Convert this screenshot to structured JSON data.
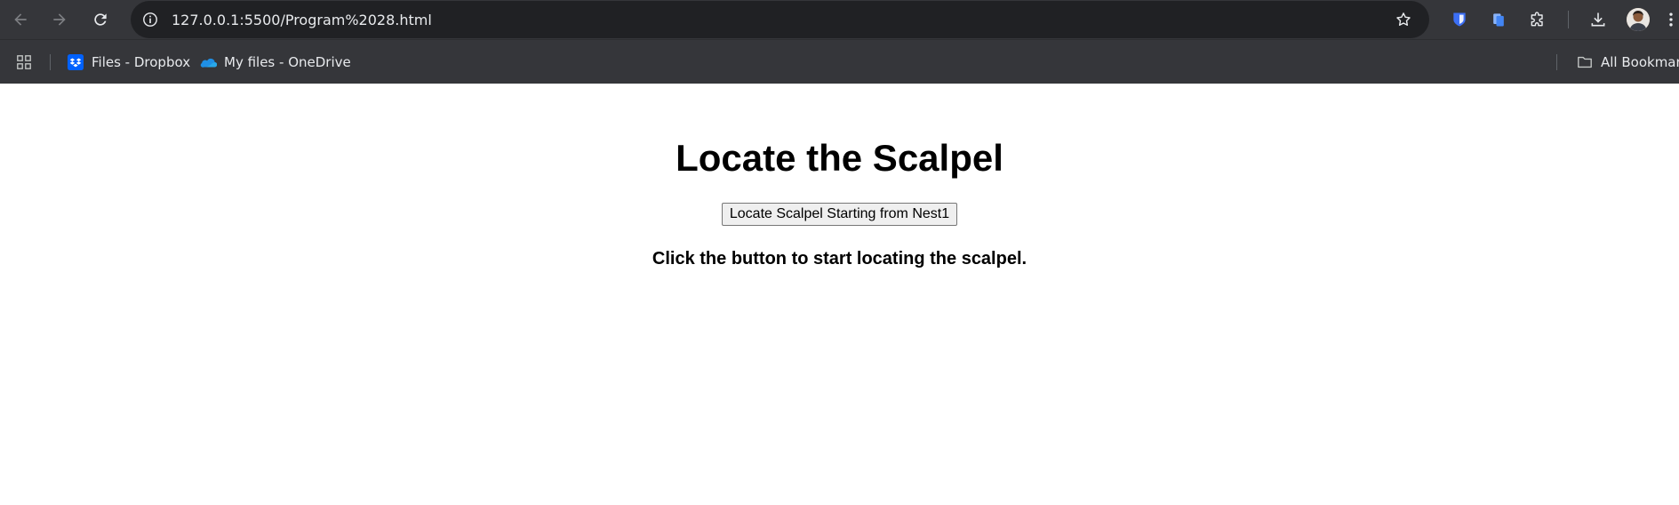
{
  "browser": {
    "url": "127.0.0.1:5500/Program%2028.html",
    "accent": "#35363a",
    "bookmarks": [
      {
        "label": "Files - Dropbox",
        "icon": "dropbox-icon"
      },
      {
        "label": "My files - OneDrive",
        "icon": "onedrive-icon"
      }
    ],
    "all_bookmarks_label": "All Bookmark"
  },
  "page": {
    "title": "Locate the Scalpel",
    "button_label": "Locate Scalpel Starting from Nest1",
    "message": "Click the button to start locating the scalpel."
  }
}
